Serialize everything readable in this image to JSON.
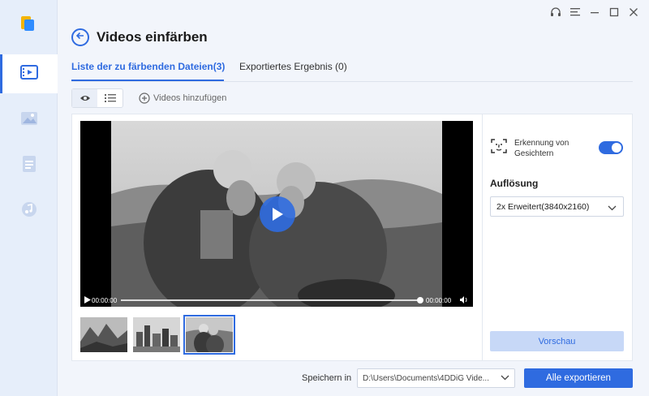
{
  "app": {
    "page_title": "Videos einfärben"
  },
  "sidebar": {
    "items": [
      {
        "icon": "video-icon",
        "active": true
      },
      {
        "icon": "image-icon",
        "active": false
      },
      {
        "icon": "document-icon",
        "active": false
      },
      {
        "icon": "music-icon",
        "active": false
      }
    ]
  },
  "window_controls": [
    "headset-icon",
    "menu-icon",
    "minimize-icon",
    "maximize-icon",
    "close-icon"
  ],
  "tabs": [
    {
      "label": "Liste der zu färbenden Dateien(3)",
      "active": true
    },
    {
      "label": "Exportiertes Ergebnis (0)",
      "active": false
    }
  ],
  "toolbar": {
    "add_videos_label": "Videos hinzufügen"
  },
  "player": {
    "current_time": "00:00:00",
    "total_time": "00:00:00",
    "progress": 1.0
  },
  "thumbnails": [
    {
      "name": "thumbnail-mountains",
      "selected": false
    },
    {
      "name": "thumbnail-city",
      "selected": false
    },
    {
      "name": "thumbnail-couple",
      "selected": true
    }
  ],
  "settings": {
    "face_detection_label": "Erkennung von Gesichtern",
    "face_detection_on": true,
    "resolution_label": "Auflösung",
    "resolution_value": "2x Erweitert(3840x2160)",
    "preview_label": "Vorschau"
  },
  "footer": {
    "save_label": "Speichern in",
    "save_path": "D:\\Users\\Documents\\4DDiG Vide...",
    "export_label": "Alle exportieren"
  },
  "colors": {
    "accent": "#2f6be0",
    "sidebar_bg": "#e6eefa",
    "preview_bg": "#c7d8f7"
  }
}
